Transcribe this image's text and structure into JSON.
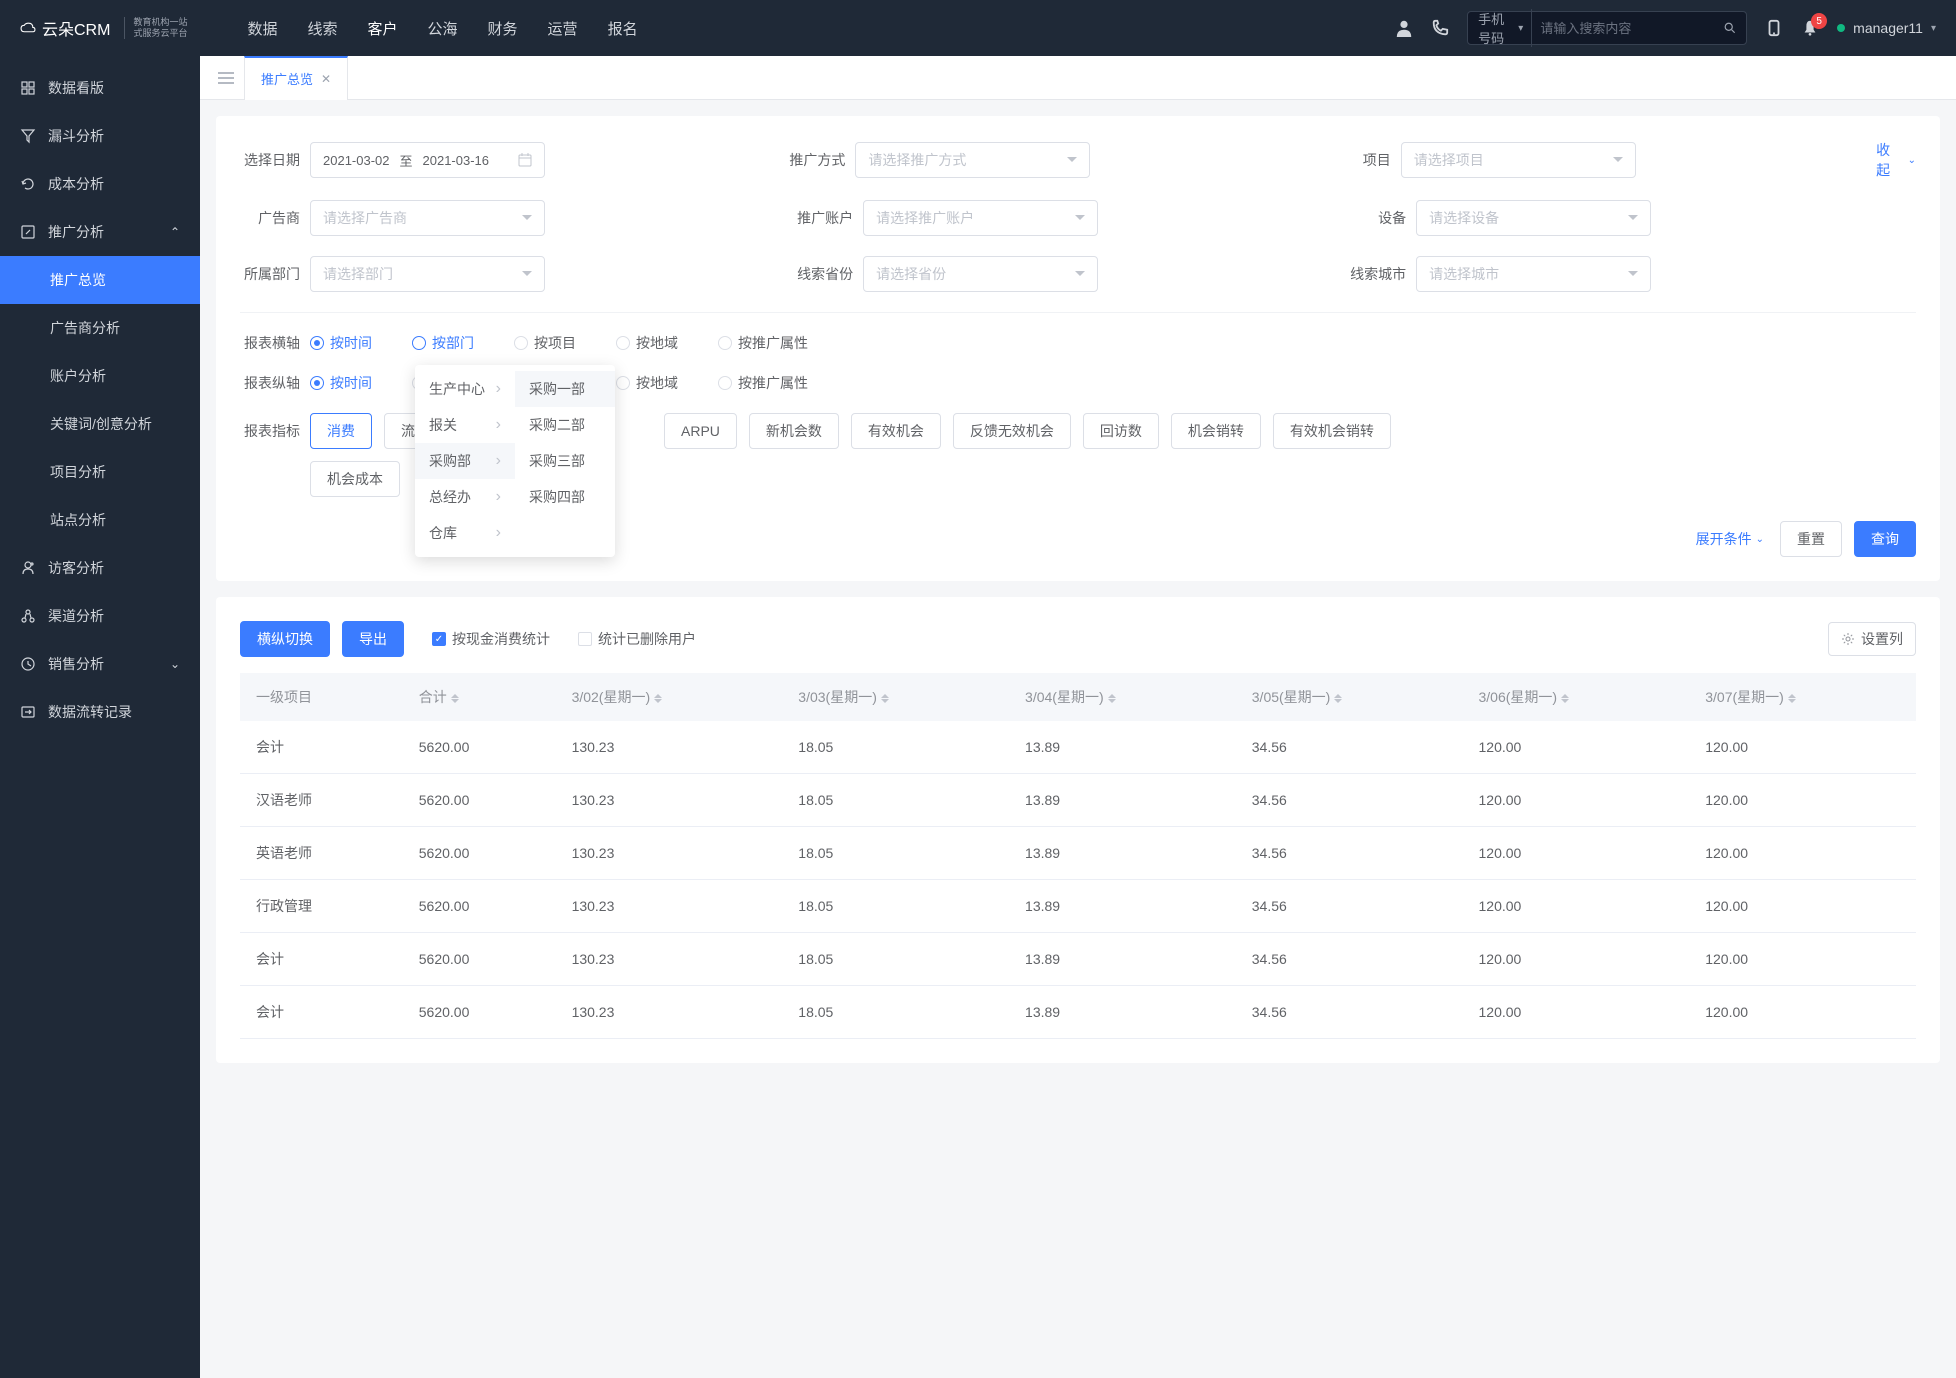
{
  "brand": {
    "name": "云朵CRM",
    "sub1": "教育机构一站",
    "sub2": "式服务云平台"
  },
  "nav": [
    "数据",
    "线索",
    "客户",
    "公海",
    "财务",
    "运营",
    "报名"
  ],
  "nav_active": 2,
  "search": {
    "prefix": "手机号码",
    "placeholder": "请输入搜索内容"
  },
  "notif_count": "5",
  "user": "manager11",
  "sidebar": [
    {
      "label": "数据看版",
      "icon": "dashboard"
    },
    {
      "label": "漏斗分析",
      "icon": "funnel"
    },
    {
      "label": "成本分析",
      "icon": "refresh"
    },
    {
      "label": "推广分析",
      "icon": "edit",
      "expandable": true,
      "expanded": true,
      "children": [
        {
          "label": "推广总览",
          "active": true
        },
        {
          "label": "广告商分析"
        },
        {
          "label": "账户分析"
        },
        {
          "label": "关键词/创意分析"
        },
        {
          "label": "项目分析"
        },
        {
          "label": "站点分析"
        }
      ]
    },
    {
      "label": "访客分析",
      "icon": "visitor"
    },
    {
      "label": "渠道分析",
      "icon": "channel"
    },
    {
      "label": "销售分析",
      "icon": "sales",
      "expandable": true
    },
    {
      "label": "数据流转记录",
      "icon": "flow"
    }
  ],
  "tab": {
    "label": "推广总览"
  },
  "filters": {
    "date_label": "选择日期",
    "date_from": "2021-03-02",
    "date_to": "2021-03-16",
    "date_sep": "至",
    "method_label": "推广方式",
    "method_ph": "请选择推广方式",
    "project_label": "项目",
    "project_ph": "请选择项目",
    "advertiser_label": "广告商",
    "advertiser_ph": "请选择广告商",
    "account_label": "推广账户",
    "account_ph": "请选择推广账户",
    "device_label": "设备",
    "device_ph": "请选择设备",
    "dept_label": "所属部门",
    "dept_ph": "请选择部门",
    "province_label": "线索省份",
    "province_ph": "请选择省份",
    "city_label": "线索城市",
    "city_ph": "请选择城市",
    "collapse": "收起"
  },
  "axes": {
    "h_label": "报表横轴",
    "v_label": "报表纵轴",
    "options": [
      "按时间",
      "按部门",
      "按项目",
      "按地域",
      "按推广属性"
    ]
  },
  "dropdown": {
    "col1": [
      "生产中心",
      "报关",
      "采购部",
      "总经办",
      "仓库"
    ],
    "col2": [
      "采购一部",
      "采购二部",
      "采购三部",
      "采购四部"
    ]
  },
  "metrics": {
    "label": "报表指标",
    "items": [
      "消费",
      "流",
      "ARPU",
      "新机会数",
      "有效机会",
      "反馈无效机会",
      "回访数",
      "机会销转",
      "有效机会销转",
      "机会成本"
    ]
  },
  "actions": {
    "expand": "展开条件",
    "reset": "重置",
    "query": "查询"
  },
  "toolbar": {
    "swap": "横纵切换",
    "export": "导出",
    "cash": "按现金消费统计",
    "deleted": "统计已删除用户",
    "columns": "设置列"
  },
  "table": {
    "headers": [
      "一级项目",
      "合计",
      "3/02(星期一)",
      "3/03(星期一)",
      "3/04(星期一)",
      "3/05(星期一)",
      "3/06(星期一)",
      "3/07(星期一)"
    ],
    "rows": [
      [
        "会计",
        "5620.00",
        "130.23",
        "18.05",
        "13.89",
        "34.56",
        "120.00",
        "120.00"
      ],
      [
        "汉语老师",
        "5620.00",
        "130.23",
        "18.05",
        "13.89",
        "34.56",
        "120.00",
        "120.00"
      ],
      [
        "英语老师",
        "5620.00",
        "130.23",
        "18.05",
        "13.89",
        "34.56",
        "120.00",
        "120.00"
      ],
      [
        "行政管理",
        "5620.00",
        "130.23",
        "18.05",
        "13.89",
        "34.56",
        "120.00",
        "120.00"
      ],
      [
        "会计",
        "5620.00",
        "130.23",
        "18.05",
        "13.89",
        "34.56",
        "120.00",
        "120.00"
      ],
      [
        "会计",
        "5620.00",
        "130.23",
        "18.05",
        "13.89",
        "34.56",
        "120.00",
        "120.00"
      ]
    ]
  }
}
